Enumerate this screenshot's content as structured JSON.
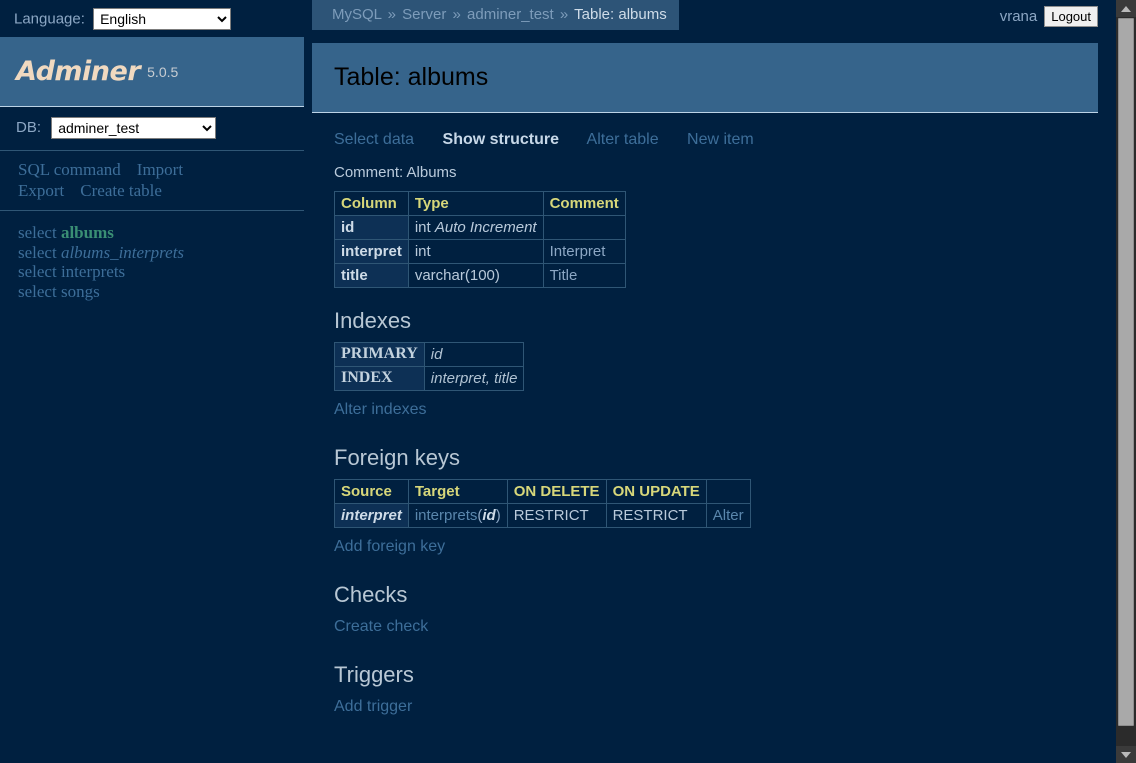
{
  "topbar": {
    "language_label": "Language:",
    "language_value": "English",
    "language_options": [
      "English"
    ],
    "user": "vrana",
    "logout_label": "Logout"
  },
  "sidebar": {
    "brand_name": "Adminer",
    "brand_version": "5.0.5",
    "db_label": "DB:",
    "db_value": "adminer_test",
    "db_options": [
      "adminer_test"
    ],
    "menu_links": [
      {
        "label": "SQL command"
      },
      {
        "label": "Import"
      },
      {
        "label": "Export"
      },
      {
        "label": "Create table"
      }
    ],
    "select_prefix": "select",
    "tables": [
      {
        "name": "albums",
        "style": "active"
      },
      {
        "name": "albums_interprets",
        "style": "italic"
      },
      {
        "name": "interprets",
        "style": "normal"
      },
      {
        "name": "songs",
        "style": "normal"
      }
    ]
  },
  "breadcrumb": {
    "items": [
      "MySQL",
      "Server",
      "adminer_test"
    ],
    "separator": "»",
    "current": "Table: albums"
  },
  "page": {
    "title": "Table: albums",
    "tabs": [
      {
        "label": "Select data",
        "active": false
      },
      {
        "label": "Show structure",
        "active": true
      },
      {
        "label": "Alter table",
        "active": false
      },
      {
        "label": "New item",
        "active": false
      }
    ],
    "comment": "Comment: Albums"
  },
  "columns_table": {
    "headers": [
      "Column",
      "Type",
      "Comment"
    ],
    "rows": [
      {
        "column": "id",
        "type_plain": "int",
        "type_ital": "Auto Increment",
        "comment": ""
      },
      {
        "column": "interpret",
        "type_plain": "int",
        "type_ital": "",
        "comment": "Interpret"
      },
      {
        "column": "title",
        "type_plain": "varchar(100)",
        "type_ital": "",
        "comment": "Title"
      }
    ]
  },
  "indexes": {
    "heading": "Indexes",
    "rows": [
      {
        "type": "PRIMARY",
        "columns": "id"
      },
      {
        "type": "INDEX",
        "columns": "interpret, title"
      }
    ],
    "alter_link": "Alter indexes"
  },
  "foreign_keys": {
    "heading": "Foreign keys",
    "headers": [
      "Source",
      "Target",
      "ON DELETE",
      "ON UPDATE",
      ""
    ],
    "rows": [
      {
        "source": "interpret",
        "target_table": "interprets",
        "target_open": "(",
        "target_col": "id",
        "target_close": ")",
        "on_delete": "RESTRICT",
        "on_update": "RESTRICT",
        "action": "Alter"
      }
    ],
    "add_link": "Add foreign key"
  },
  "checks": {
    "heading": "Checks",
    "create_link": "Create check"
  },
  "triggers": {
    "heading": "Triggers",
    "add_link": "Add trigger"
  },
  "colors": {
    "page_bg": "#002040",
    "panel_bg": "#36648b",
    "accent_link": "#3d6e99",
    "header_text": "#d7d77a",
    "active_table": "#3a8f74"
  }
}
